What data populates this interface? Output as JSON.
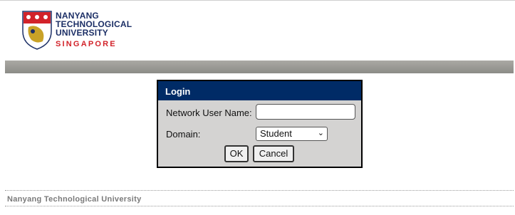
{
  "header": {
    "logo_line1": "NANYANG",
    "logo_line2": "TECHNOLOGICAL",
    "logo_line3": "UNIVERSITY",
    "logo_line4": "SINGAPORE",
    "brand_color": "#1c2f66",
    "accent_color": "#d2232a"
  },
  "login": {
    "title": "Login",
    "username_label": "Network User Name:",
    "username_value": "",
    "domain_label": "Domain:",
    "domain_selected": "Student",
    "ok_label": "OK",
    "cancel_label": "Cancel",
    "title_bar_color": "#002b66"
  },
  "footer": {
    "text": "Nanyang Technological University"
  }
}
